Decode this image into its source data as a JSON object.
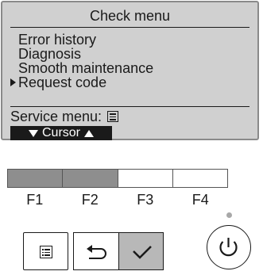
{
  "screen": {
    "title": "Check menu",
    "items": [
      {
        "label": "Error history"
      },
      {
        "label": "Diagnosis"
      },
      {
        "label": "Smooth maintenance"
      },
      {
        "label": "Request code",
        "selected": true
      }
    ],
    "service_label": "Service menu:",
    "cursor_label": "Cursor"
  },
  "function_keys": [
    {
      "label": "F1",
      "active": true
    },
    {
      "label": "F2",
      "active": true
    },
    {
      "label": "F3",
      "active": false
    },
    {
      "label": "F4",
      "active": false
    }
  ],
  "buttons": {
    "menu_icon": "menu-list-icon",
    "return_icon": "return-arrow-icon",
    "confirm_icon": "checkmark-icon",
    "power_icon": "power-icon"
  },
  "colors": {
    "screen_bg": "#d0d0d0",
    "key_active": "#8e8e8e",
    "confirm_button": "#b8b8b8"
  }
}
